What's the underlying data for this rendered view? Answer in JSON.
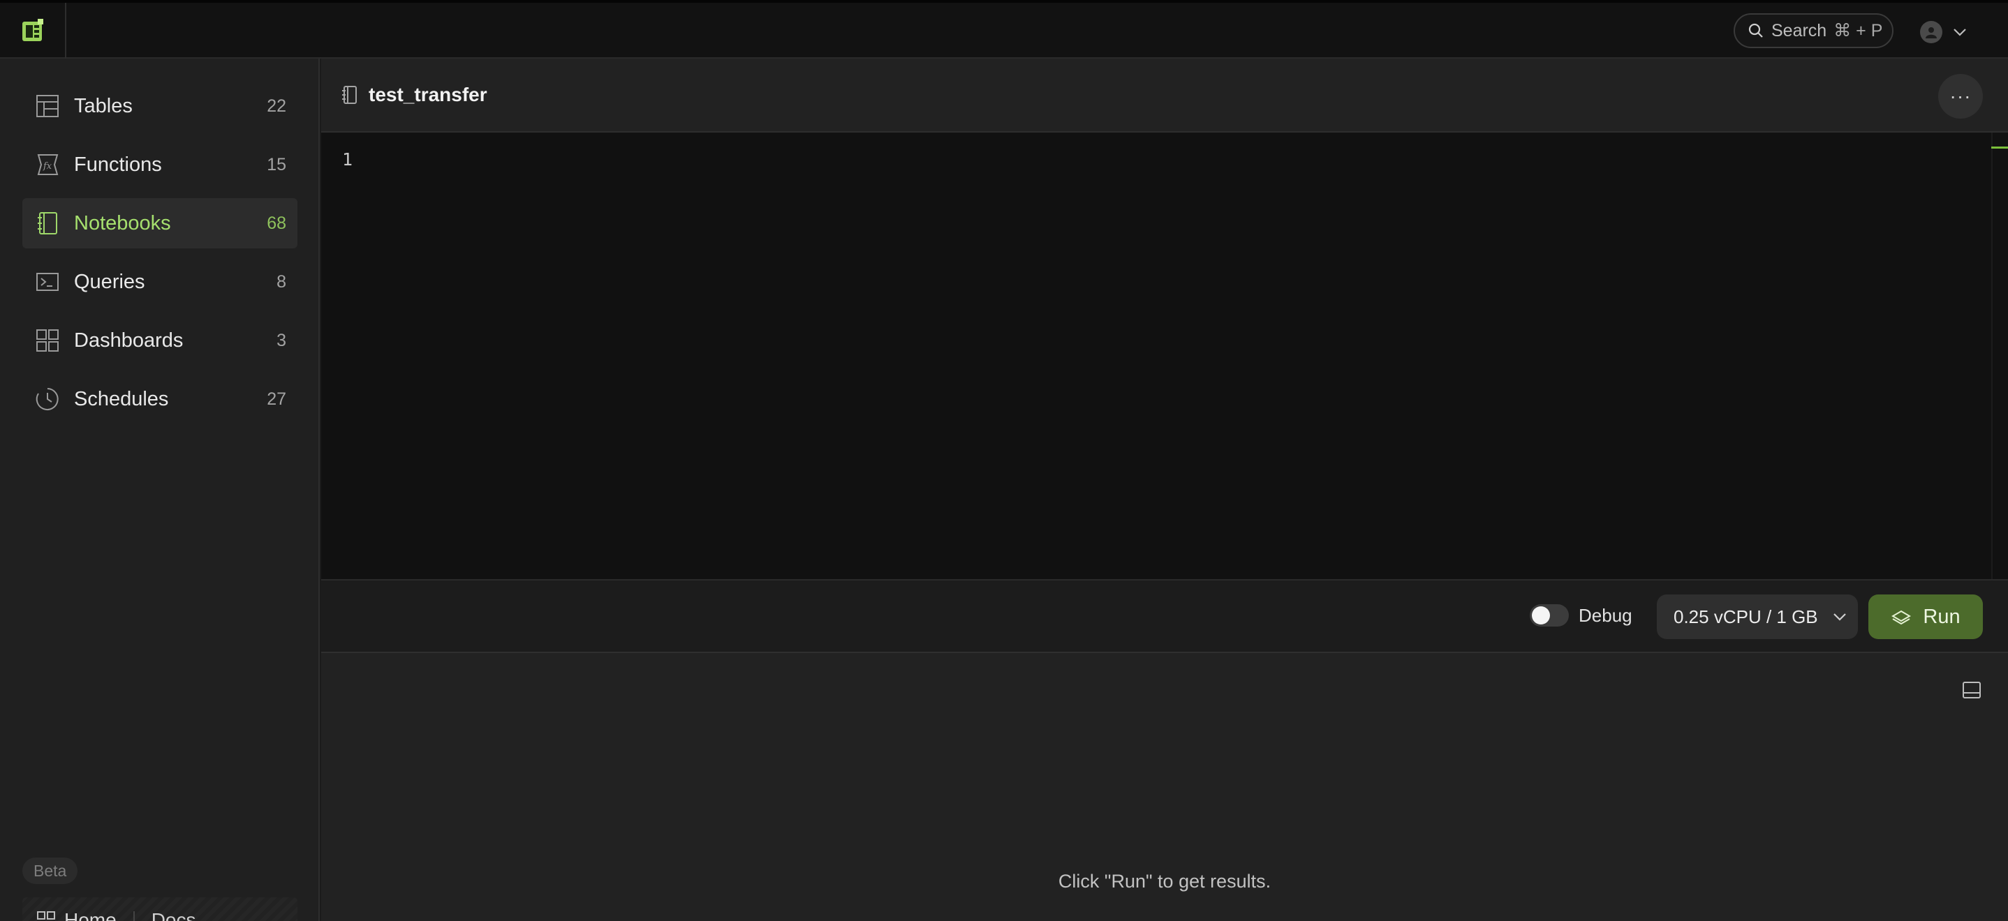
{
  "topbar": {
    "search_label": "Search",
    "search_shortcut": "⌘ + P"
  },
  "sidebar": {
    "items": [
      {
        "label": "Tables",
        "count": "22",
        "icon": "table-icon"
      },
      {
        "label": "Functions",
        "count": "15",
        "icon": "function-icon"
      },
      {
        "label": "Notebooks",
        "count": "68",
        "icon": "notebook-icon",
        "active": true
      },
      {
        "label": "Queries",
        "count": "8",
        "icon": "terminal-icon"
      },
      {
        "label": "Dashboards",
        "count": "3",
        "icon": "dashboard-icon"
      },
      {
        "label": "Schedules",
        "count": "27",
        "icon": "clock-icon"
      }
    ],
    "beta_badge": "Beta",
    "home_label": "Home",
    "docs_label": "Docs"
  },
  "document": {
    "title": "test_transfer",
    "more_label": "···"
  },
  "editor": {
    "line_numbers": [
      "1"
    ]
  },
  "toolbar": {
    "debug_label": "Debug",
    "compute_value": "0.25 vCPU / 1 GB",
    "run_label": "Run"
  },
  "results": {
    "empty_message": "Click \"Run\" to get results."
  },
  "colors": {
    "accent_green": "#a6e06e",
    "run_button": "#4c6b2b",
    "background": "#1b1b1b"
  }
}
